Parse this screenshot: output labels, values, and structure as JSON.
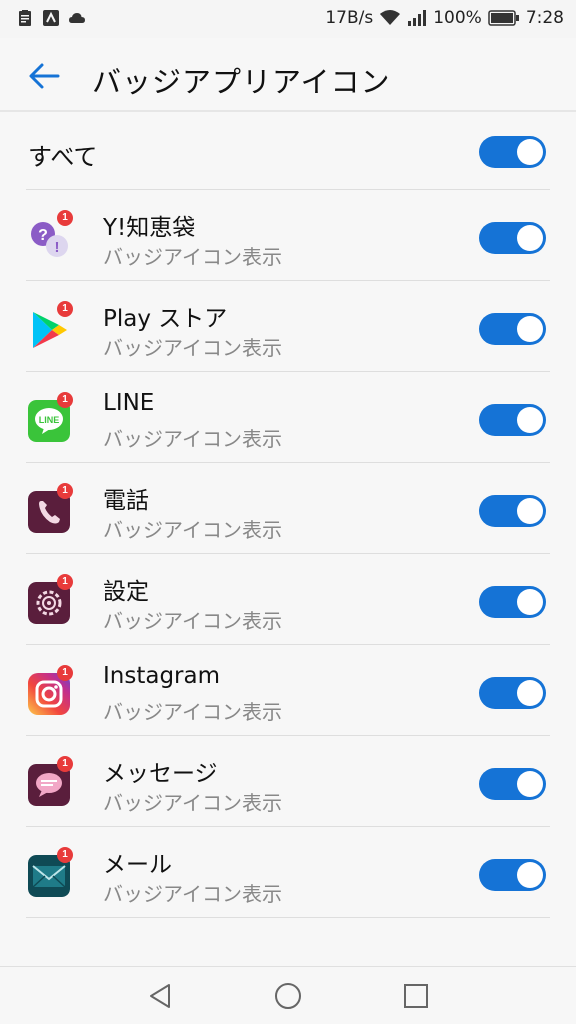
{
  "status_bar": {
    "left_icons": [
      "clipboard-icon",
      "sync-app-icon",
      "cloud-icon"
    ],
    "network_speed": "17B/s",
    "battery": "100%",
    "time": "7:28"
  },
  "header": {
    "back_icon": "back-arrow-icon",
    "title": "バッジアプリアイコン"
  },
  "all_row": {
    "label": "すべて",
    "toggle_on": true
  },
  "apps": [
    {
      "name": "Y!知恵袋",
      "subtitle": "バッジアイコン表示",
      "badge": "1",
      "toggle_on": true,
      "icon": "yahoo-chiebukuro-icon"
    },
    {
      "name": "Play ストア",
      "subtitle": "バッジアイコン表示",
      "badge": "1",
      "toggle_on": true,
      "icon": "play-store-icon"
    },
    {
      "name": "LINE",
      "subtitle": "バッジアイコン表示",
      "badge": "1",
      "toggle_on": true,
      "icon": "line-icon"
    },
    {
      "name": "電話",
      "subtitle": "バッジアイコン表示",
      "badge": "1",
      "toggle_on": true,
      "icon": "phone-icon"
    },
    {
      "name": "設定",
      "subtitle": "バッジアイコン表示",
      "badge": "1",
      "toggle_on": true,
      "icon": "settings-icon"
    },
    {
      "name": "Instagram",
      "subtitle": "バッジアイコン表示",
      "badge": "1",
      "toggle_on": true,
      "icon": "instagram-icon"
    },
    {
      "name": "メッセージ",
      "subtitle": "バッジアイコン表示",
      "badge": "1",
      "toggle_on": true,
      "icon": "messages-icon"
    },
    {
      "name": "メール",
      "subtitle": "バッジアイコン表示",
      "badge": "1",
      "toggle_on": true,
      "icon": "mail-icon"
    }
  ],
  "colors": {
    "accent": "#1573d6",
    "badge": "#e83b3b",
    "subtitle": "#888888"
  },
  "nav_bar": [
    "back-triangle-icon",
    "home-circle-icon",
    "recents-square-icon"
  ]
}
